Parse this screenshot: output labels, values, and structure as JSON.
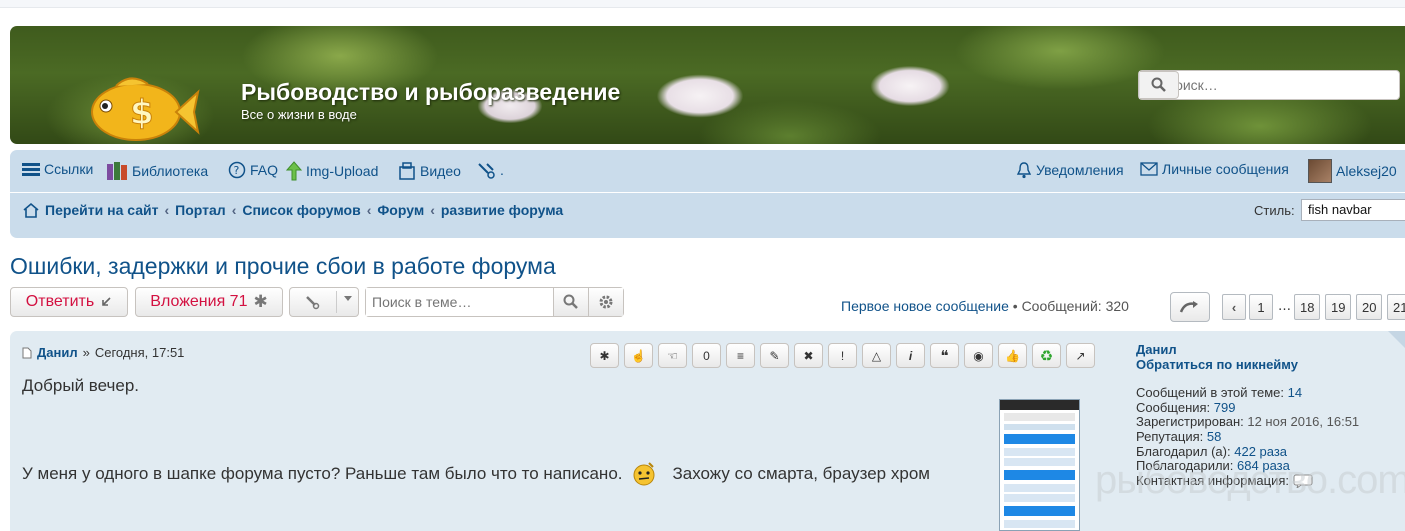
{
  "header": {
    "site_title": "Рыбоводство и рыборазведение",
    "site_description": "Все о жизни в воде",
    "search_placeholder": "Поиск…",
    "search_icon": "search-icon",
    "logo_icon": "goldfish-logo"
  },
  "nav": {
    "items": [
      {
        "label": "Ссылки",
        "icon": "menu-icon"
      },
      {
        "label": "Библиотека",
        "icon": "books-icon"
      },
      {
        "label": "FAQ",
        "icon": "faq-icon"
      },
      {
        "label": "Img-Upload",
        "icon": "upload-arrow-icon"
      },
      {
        "label": "Видео",
        "icon": "video-icon"
      },
      {
        "label": ".",
        "icon": "tools-icon"
      }
    ],
    "notifications": "Уведомления",
    "private_messages": "Личные сообщения",
    "username": "Aleksej20"
  },
  "breadcrumbs": [
    "Перейти на сайт",
    "Портал",
    "Список форумов",
    "Форум",
    "развитие форума"
  ],
  "style_switcher": {
    "label": "Стиль:",
    "value": "fish navbar"
  },
  "topic": {
    "title": "Ошибки, задержки и прочие сбои в работе форума",
    "reply_label": "Ответить",
    "attachments_label": "Вложения 71",
    "search_placeholder": "Поиск в теме…",
    "first_unread": "Первое новое сообщение",
    "posts_count": "Сообщений: 320",
    "pages": [
      "1",
      "18",
      "19",
      "20",
      "21"
    ],
    "ellipsis": "…"
  },
  "post": {
    "author": "Данил",
    "date_sep": "»",
    "date": "Сегодня, 17:51",
    "tools": [
      "*",
      "quote",
      "quote-reply",
      "0",
      "≡",
      "✎",
      "✖",
      "!",
      "△",
      "i",
      "❝",
      "eye",
      "👍",
      "♻",
      "↗"
    ],
    "body_line1": "Добрый вечер.",
    "body_line2a": "У меня у одного в шапке форума пусто? Раньше там было что то написано.",
    "body_line2b": "Захожу со смарта, браузер хром"
  },
  "profile": {
    "name": "Данил",
    "contact_link": "Обратиться по никнейму",
    "topic_posts_label": "Сообщений в этой теме:",
    "topic_posts": "14",
    "posts_label": "Сообщения:",
    "posts": "799",
    "registered_label": "Зарегистрирован:",
    "registered": "12 ноя 2016, 16:51",
    "rep_label": "Репутация:",
    "rep": "58",
    "thanked_label": "Благодарил (а):",
    "thanked": "422 раза",
    "thanked_by_label": "Поблагодарили:",
    "thanked_by": "684 раза",
    "contact_label": "Контактная информация:"
  },
  "watermark": "рыбоводство.com",
  "colors": {
    "link": "#105289",
    "reply_red": "#d31141",
    "navbar": "#cadceb",
    "post_bg": "#e1ebf2"
  }
}
